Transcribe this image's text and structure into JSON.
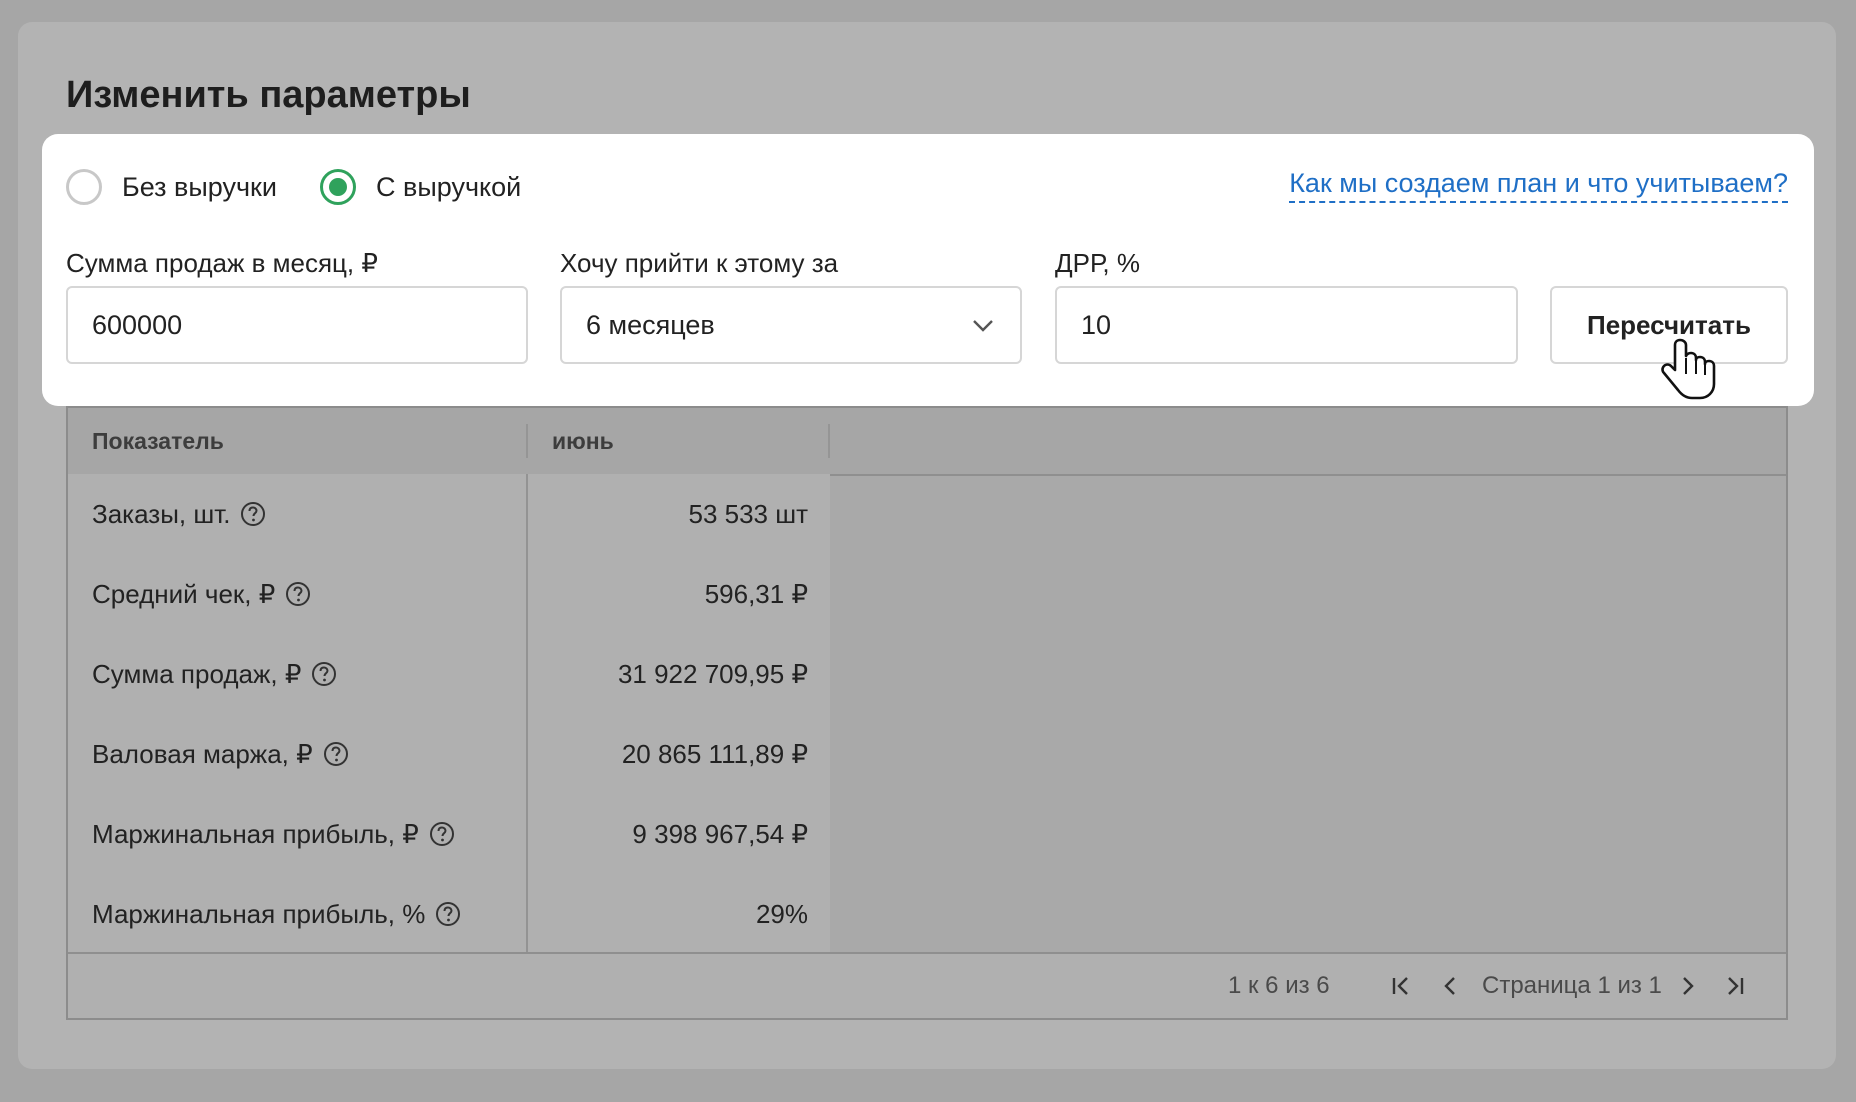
{
  "title": "Изменить параметры",
  "mode": {
    "options": [
      {
        "label": "Без выручки",
        "checked": false
      },
      {
        "label": "С выручкой",
        "checked": true
      }
    ],
    "accent_color": "#2fa25c"
  },
  "help_link": "Как мы создаем план и что учитываем?",
  "fields": {
    "sales": {
      "label": "Сумма продаж в месяц, ₽",
      "value": "600000"
    },
    "period": {
      "label": "Хочу прийти к этому за",
      "value": "6 месяцев",
      "icon": "chevron-down-icon"
    },
    "drr": {
      "label": "ДРР, %",
      "value": "10"
    }
  },
  "recalc_button": "Пересчитать",
  "table": {
    "headers": [
      "Показатель",
      "июнь"
    ],
    "rows": [
      {
        "name": "Заказы, шт.",
        "value": "53 533 шт"
      },
      {
        "name": "Средний чек, ₽",
        "value": "596,31 ₽"
      },
      {
        "name": "Сумма продаж, ₽",
        "value": "31 922 709,95 ₽"
      },
      {
        "name": "Валовая маржа, ₽",
        "value": "20 865 111,89 ₽"
      },
      {
        "name": "Маржинальная прибыль, ₽",
        "value": "9 398 967,54 ₽"
      },
      {
        "name": "Маржинальная прибыль, %",
        "value": "29%"
      }
    ]
  },
  "pagination": {
    "range_text": "1 к 6 из 6",
    "page_text": "Страница 1 из 1"
  },
  "link_color": "#1f6fc6"
}
